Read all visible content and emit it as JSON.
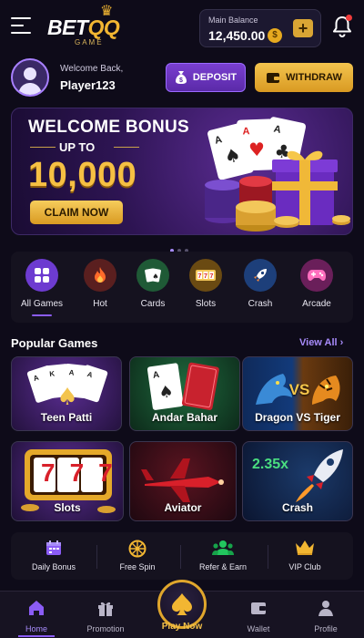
{
  "header": {
    "logo_main_1": "BET",
    "logo_main_2": "QQ",
    "logo_sub": "GAME",
    "balance_label": "Main Balance",
    "balance_value": "12,450.00",
    "coin_symbol": "$",
    "add_symbol": "+"
  },
  "user": {
    "welcome": "Welcome Back,",
    "name": "Player123"
  },
  "actions": {
    "deposit": "DEPOSIT",
    "withdraw": "WITHDRAW"
  },
  "banner": {
    "title": "WELCOME BONUS",
    "subtitle": "UP TO",
    "amount": "10,000",
    "cta": "CLAIM NOW",
    "page_count": 3,
    "active_page": 1
  },
  "categories": [
    {
      "label": "All Games",
      "icon": "grid-icon",
      "active": true
    },
    {
      "label": "Hot",
      "icon": "fire-icon"
    },
    {
      "label": "Cards",
      "icon": "cards-icon"
    },
    {
      "label": "Slots",
      "icon": "slots-icon"
    },
    {
      "label": "Crash",
      "icon": "rocket-icon"
    },
    {
      "label": "Arcade",
      "icon": "gamepad-icon"
    }
  ],
  "popular": {
    "title": "Popular Games",
    "view_all": "View All",
    "games": [
      {
        "name": "Teen Patti"
      },
      {
        "name": "Andar Bahar"
      },
      {
        "name": "Dragon VS Tiger"
      },
      {
        "name": "Slots"
      },
      {
        "name": "Aviator"
      },
      {
        "name": "Crash"
      }
    ],
    "crash_multiplier": "2.35x",
    "slot_digits": "777",
    "vs_text": "VS"
  },
  "quick_links": [
    {
      "label": "Daily Bonus",
      "icon": "calendar-icon"
    },
    {
      "label": "Free Spin",
      "icon": "wheel-icon"
    },
    {
      "label": "Refer & Earn",
      "icon": "users-icon"
    },
    {
      "label": "VIP Club",
      "icon": "crown-icon"
    }
  ],
  "nav": {
    "home": "Home",
    "promotion": "Promotion",
    "play": "Play Now",
    "wallet": "Wallet",
    "profile": "Profile"
  },
  "colors": {
    "background": "#0e0b19",
    "accent_purple": "#8b5cf6",
    "accent_gold": "#f2b632"
  }
}
